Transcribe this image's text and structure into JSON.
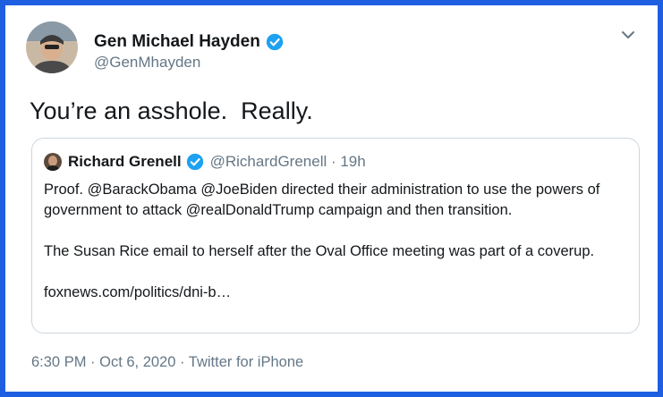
{
  "tweet": {
    "author": {
      "name": "Gen Michael Hayden",
      "handle": "@GenMhayden",
      "avatar_icon": "profile-photo"
    },
    "text": "You’re an asshole.  Really.",
    "timestamp": "6:30 PM · Oct 6, 2020 · Twitter for iPhone"
  },
  "quoted_tweet": {
    "author_name": "Richard Grenell",
    "meta": "@RichardGrenell · 19h",
    "paragraphs": [
      "Proof. @BarackObama @JoeBiden directed their administration to use the powers of government to attack @realDonaldTrump campaign and then transition.",
      "The Susan Rice email to herself after the Oval Office meeting was part of a coverup.",
      "foxnews.com/politics/dni-b…"
    ]
  },
  "icons": {
    "verified": "verified-badge-icon",
    "menu": "chevron-down-icon"
  },
  "colors": {
    "frame_border": "#1d5fe0",
    "verified_blue": "#1da1f2",
    "secondary_text": "#657786",
    "primary_text": "#14171a"
  }
}
